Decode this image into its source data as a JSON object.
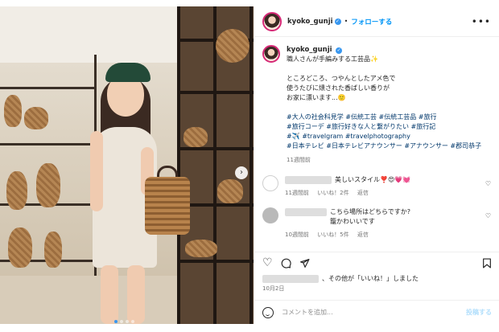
{
  "post": {
    "username": "kyoko_gunji",
    "follow_label": "フォローする",
    "more_label": "•••"
  },
  "caption": {
    "title": "職人さんが手編みする工芸品✨",
    "body": "ところどころ、つやんとしたアメ色で\n使うたびに燻された香ばしい香りが\nお家に漂います...🙂",
    "hashtags": "#大人の社会科見学 #伝統工芸 #伝統工芸品 #旅行\n#旅行コーデ #旅行好きな人と繋がりたい #旅行記\n#✈️ #travelgram #travelphotography\n#日本テレビ #日本テレビアナウンサー #アナウンサー #郡司恭子",
    "timestamp": "11週間前"
  },
  "comments": [
    {
      "text": "美しいスタイル❣️😍💗💓",
      "time": "11週間前",
      "likes": "いいね！2件",
      "reply": "返信"
    },
    {
      "text": "こちら場所はどちらですか?\n籠かわいいです",
      "time": "10週間前",
      "likes": "いいね！5件",
      "reply": "返信"
    }
  ],
  "liked_by": "、その他が「いいね！」しました",
  "post_date": "10月2日",
  "add_comment": {
    "placeholder": "コメントを追加...",
    "post_label": "投稿する"
  },
  "icons": [
    "heart-icon",
    "comment-icon",
    "share-icon",
    "bookmark-icon",
    "emoji-icon",
    "verified-icon",
    "chevron-right-icon"
  ],
  "colors": {
    "accent": "#0095f6",
    "link": "#00376b",
    "muted": "#737373"
  }
}
